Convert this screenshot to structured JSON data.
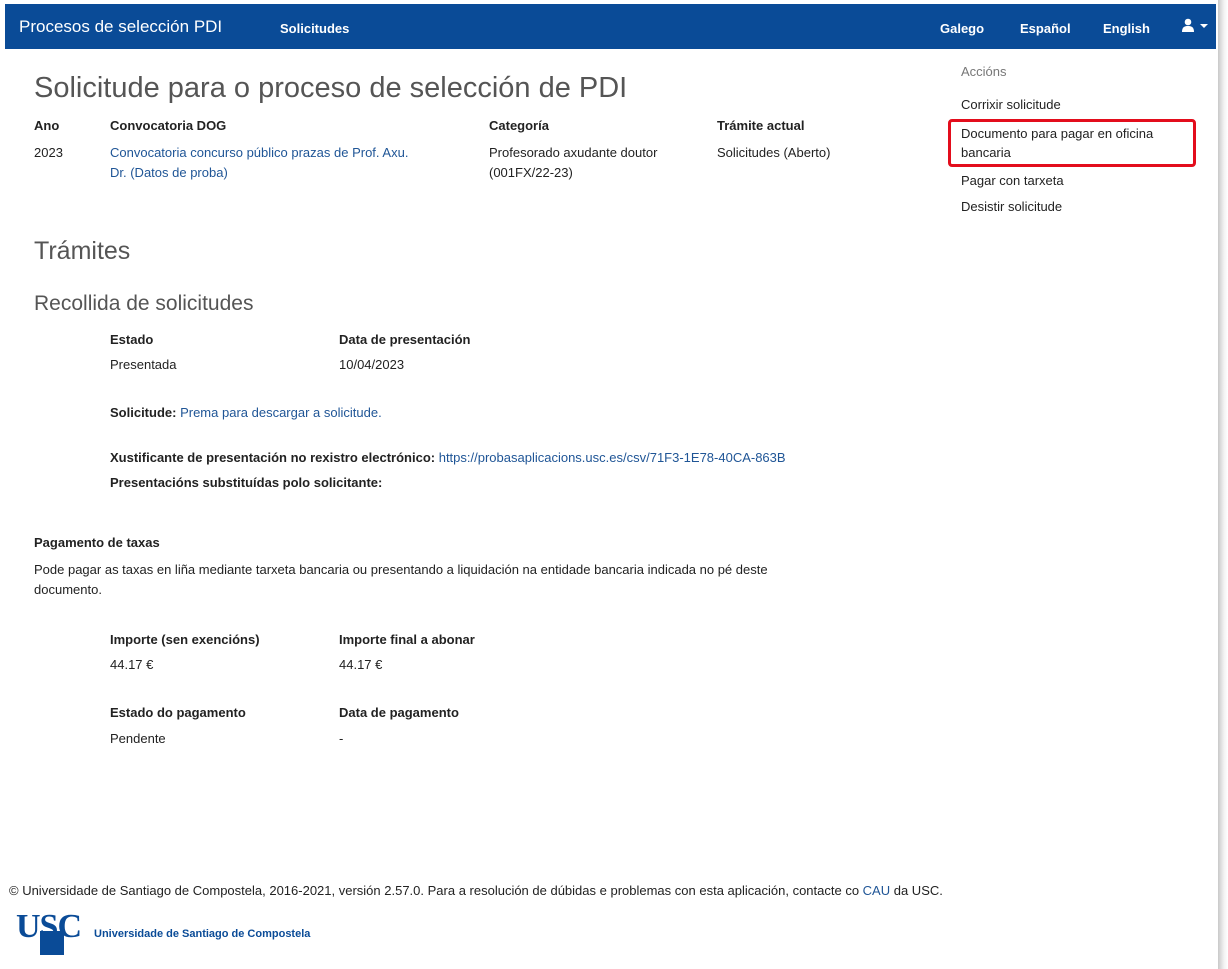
{
  "navbar": {
    "brand": "Procesos de selección PDI",
    "solicitudes": "Solicitudes",
    "lang_gl": "Galego",
    "lang_es": "Español",
    "lang_en": "English",
    "user_icon": "user-icon"
  },
  "title": "Solicitude para o proceso de selección de PDI",
  "info": {
    "ano_label": "Ano",
    "ano_value": "2023",
    "convocatoria_label": "Convocatoria DOG",
    "convocatoria_line1": "Convocatoria concurso público prazas de Prof. Axu.",
    "convocatoria_line2": "Dr. (Datos de proba)",
    "categoria_label": "Categoría",
    "categoria_line1": "Profesorado axudante doutor",
    "categoria_line2": "(001FX/22-23)",
    "tramite_label": "Trámite actual",
    "tramite_value": "Solicitudes (Aberto)"
  },
  "actions": {
    "title": "Accións",
    "corrixir": "Corrixir solicitude",
    "documento_line1": "Documento para pagar en oficina",
    "documento_line2": "bancaria",
    "pagar": "Pagar con tarxeta",
    "desistir": "Desistir solicitude"
  },
  "tramites_heading": "Trámites",
  "recollida": {
    "heading": "Recollida de solicitudes",
    "estado_label": "Estado",
    "estado_value": "Presentada",
    "data_label": "Data de presentación",
    "data_value": "10/04/2023",
    "solicitude_label": "Solicitude:",
    "solicitude_link": "Prema para descargar a solicitude.",
    "xustificante_label": "Xustificante de presentación no rexistro electrónico:",
    "xustificante_link": "https://probasaplicacions.usc.es/csv/71F3-1E78-40CA-863B",
    "presentacions_label": "Presentacións substituídas polo solicitante:"
  },
  "pagamento": {
    "heading": "Pagamento de taxas",
    "desc_line1": "Pode pagar as taxas en liña mediante tarxeta bancaria ou presentando a liquidación na entidade bancaria indicada no pé deste",
    "desc_line2": "documento.",
    "importe_label": "Importe (sen exencións)",
    "importe_value": "44.17 €",
    "final_label": "Importe final a abonar",
    "final_value": "44.17 €",
    "estado_label": "Estado do pagamento",
    "estado_value": "Pendente",
    "data_label": "Data de pagamento",
    "data_value": "-"
  },
  "footer": {
    "text_before": "© Universidade de Santiago de Compostela, 2016-2021, versión 2.57.0. Para a resolución de dúbidas e problemas con esta aplicación, contacte co ",
    "cau_link": "CAU",
    "text_after": " da USC.",
    "logo_letters": "USC",
    "logo_name": "Universidade de Santiago de Compostela"
  },
  "colors": {
    "navbar": "#0a4b97",
    "link": "#1f5596",
    "highlight": "#e30d1c"
  }
}
